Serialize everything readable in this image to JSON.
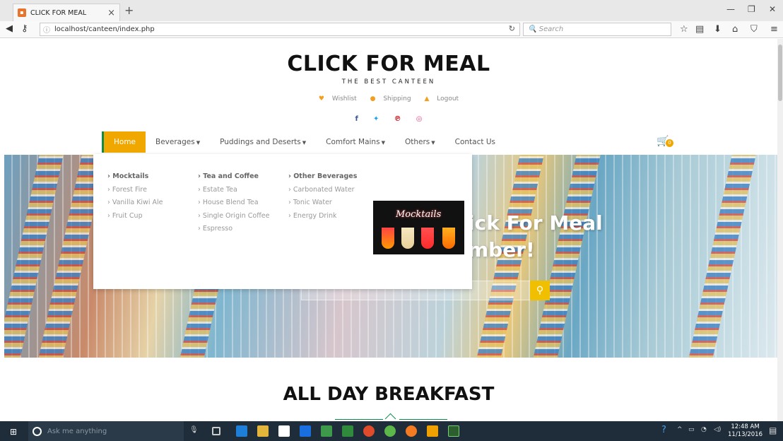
{
  "browser": {
    "tab_title": "CLICK FOR MEAL",
    "url": "localhost/canteen/index.php",
    "search_placeholder": "Search"
  },
  "site": {
    "title": "CLICK FOR MEAL",
    "subtitle": "THE BEST CANTEEN",
    "links": [
      "Wishlist",
      "Shipping",
      "Logout"
    ],
    "social_icons": [
      "facebook-icon",
      "twitter-icon",
      "pinterest-icon",
      "dribbble-icon"
    ]
  },
  "menu": {
    "items": [
      "Home",
      "Beverages",
      "Puddings and Deserts",
      "Comfort Mains",
      "Others",
      "Contact Us"
    ],
    "cart_count": "0"
  },
  "dropdown": {
    "col1": [
      "Mocktails",
      "Forest Fire",
      "Vanilla Kiwi Ale",
      "Fruit Cup"
    ],
    "col2": [
      "Tea and Coffee",
      "Estate Tea",
      "House Blend Tea",
      "Single Origin Coffee",
      "Espresso"
    ],
    "col3": [
      "Other Beverages",
      "Carbonated Water",
      "Tonic Water",
      "Energy Drink"
    ],
    "image_label": "Mocktails"
  },
  "hero": {
    "line1": "ick For Meal",
    "line2": "mber!"
  },
  "section": {
    "title": "ALL DAY BREAKFAST"
  },
  "taskbar": {
    "search_placeholder": "Ask me anything",
    "time": "12:48 AM",
    "date": "11/13/2016"
  },
  "colors": {
    "accent": "#f0a800",
    "green": "#0c8b4c"
  }
}
